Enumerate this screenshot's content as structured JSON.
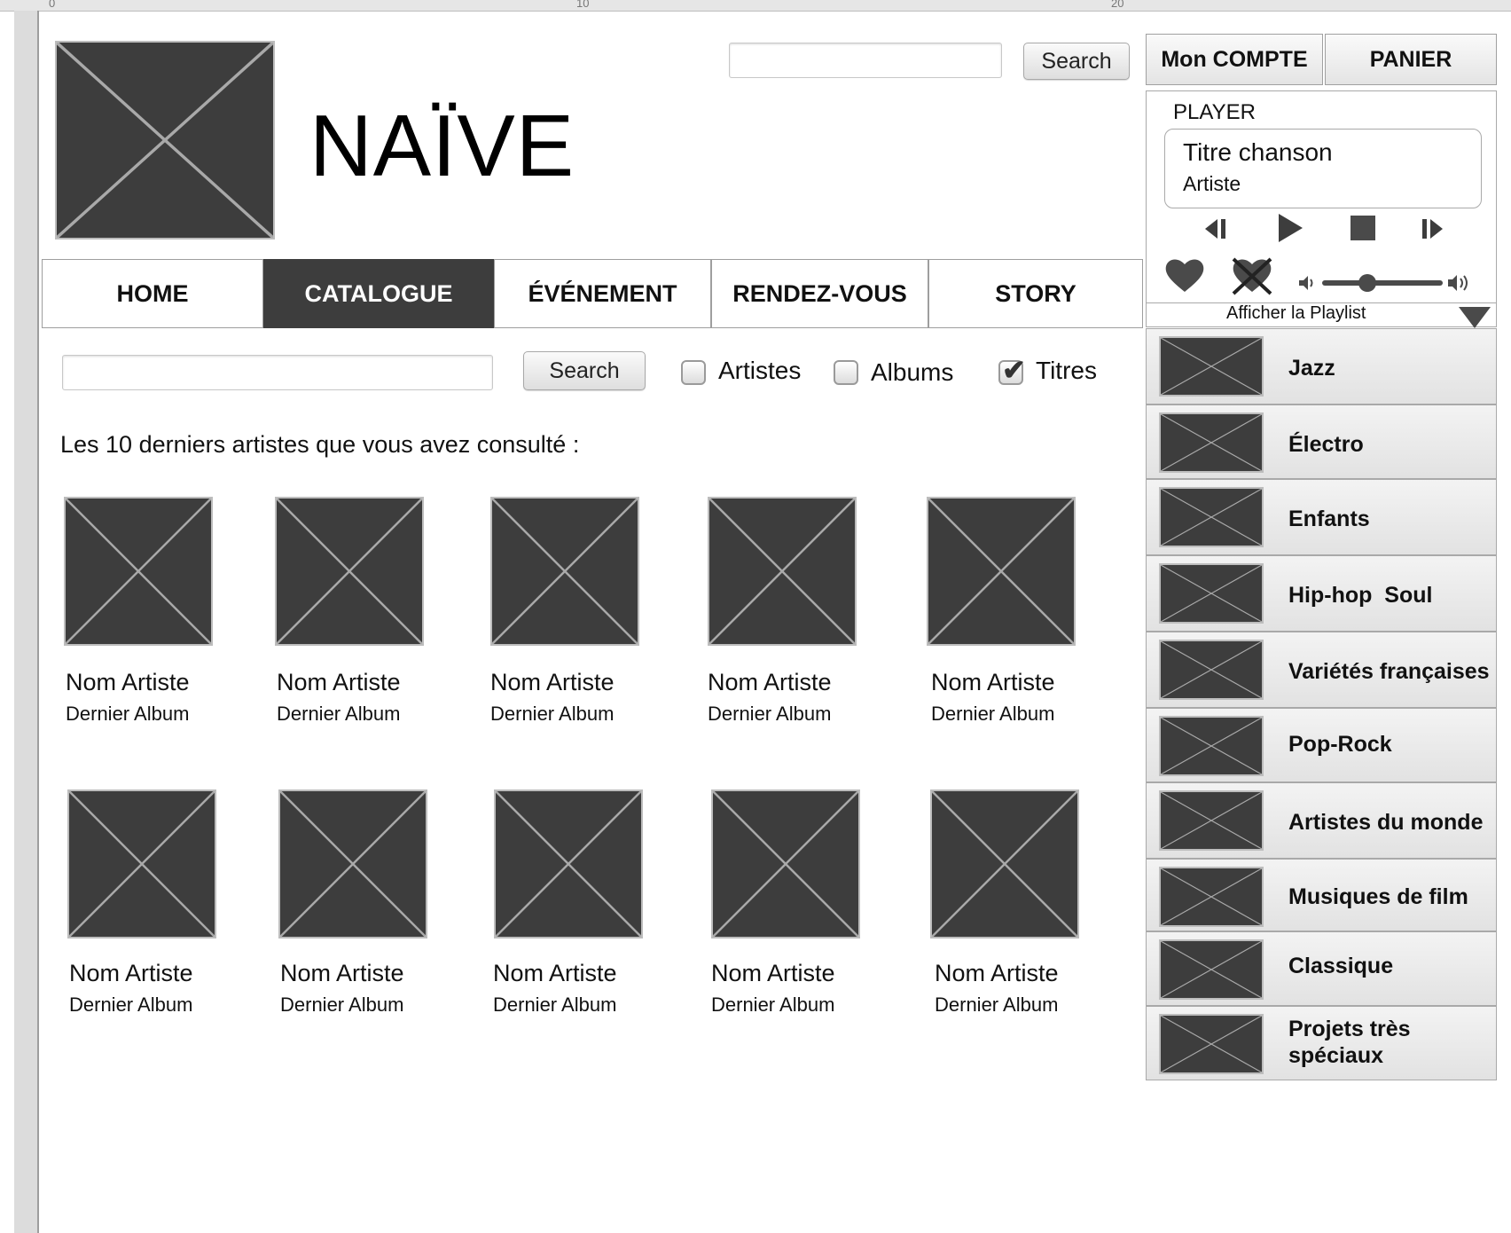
{
  "header": {
    "site_title": "NAÏVE",
    "search_button": "Search",
    "search_placeholder": ""
  },
  "nav": {
    "tabs": [
      "HOME",
      "CATALOGUE",
      "ÉVÉNEMENT",
      "RENDEZ-VOUS",
      "STORY"
    ],
    "active_tab": "CATALOGUE"
  },
  "account": {
    "my_account": "Mon COMPTE",
    "cart": "PANIER"
  },
  "player": {
    "label": "PLAYER",
    "song_title": "Titre chanson",
    "artist": "Artiste",
    "show_playlist": "Afficher la Playlist",
    "volume": 0.35
  },
  "catalog_search": {
    "button": "Search",
    "placeholder": "",
    "filters": [
      {
        "label": "Artistes",
        "checked": false
      },
      {
        "label": "Albums",
        "checked": false
      },
      {
        "label": "Titres",
        "checked": true
      }
    ]
  },
  "recent": {
    "title": "Les 10 derniers artistes que vous avez consulté :",
    "artists": [
      {
        "name": "Nom Artiste",
        "album": "Dernier Album"
      },
      {
        "name": "Nom Artiste",
        "album": "Dernier Album"
      },
      {
        "name": "Nom Artiste",
        "album": "Dernier Album"
      },
      {
        "name": "Nom Artiste",
        "album": "Dernier Album"
      },
      {
        "name": "Nom Artiste",
        "album": "Dernier Album"
      },
      {
        "name": "Nom Artiste",
        "album": "Dernier Album"
      },
      {
        "name": "Nom Artiste",
        "album": "Dernier Album"
      },
      {
        "name": "Nom Artiste",
        "album": "Dernier Album"
      },
      {
        "name": "Nom Artiste",
        "album": "Dernier Album"
      },
      {
        "name": "Nom Artiste",
        "album": "Dernier Album"
      }
    ]
  },
  "genres": [
    "Jazz",
    "Électro",
    "Enfants",
    "Hip-hop  Soul",
    "Variétés françaises",
    "Pop-Rock",
    "Artistes du monde",
    "Musiques de film",
    "Classique",
    "Projets très spéciaux"
  ],
  "ruler": {
    "marks": [
      "0",
      "10",
      "20"
    ]
  }
}
